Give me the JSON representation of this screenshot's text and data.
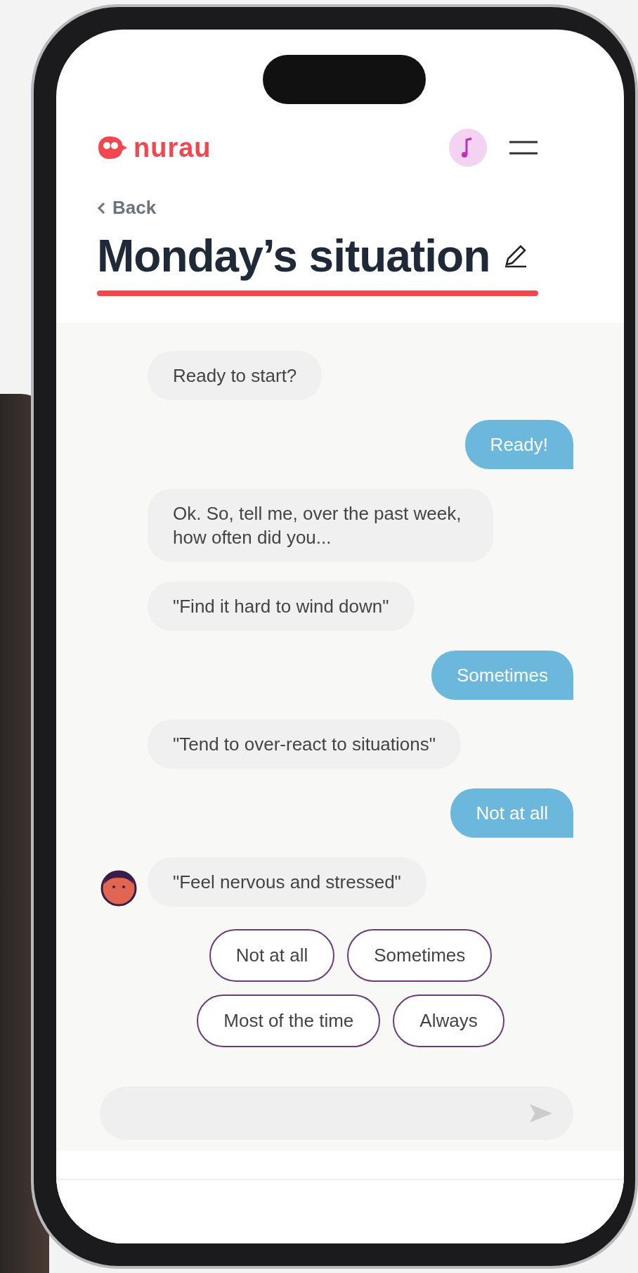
{
  "header": {
    "logo": "nurau",
    "back": "Back",
    "title": "Monday’s situation"
  },
  "messages": [
    {
      "kind": "bot",
      "text": "Ready to start?",
      "show_avatar": false
    },
    {
      "kind": "user",
      "text": "Ready!",
      "show_avatar": false
    },
    {
      "kind": "bot",
      "text": "Ok. So, tell me, over the past week, how often did you...",
      "show_avatar": false
    },
    {
      "kind": "bot",
      "text": "\"Find it hard to wind down\"",
      "show_avatar": false
    },
    {
      "kind": "user",
      "text": "Sometimes",
      "show_avatar": false
    },
    {
      "kind": "bot",
      "text": "\"Tend to over-react to situations\"",
      "show_avatar": false
    },
    {
      "kind": "user",
      "text": "Not at all",
      "show_avatar": false
    },
    {
      "kind": "bot",
      "text": "\"Feel nervous and stressed\"",
      "show_avatar": true
    }
  ],
  "quick_replies": [
    "Not at all",
    "Sometimes",
    "Most of the time",
    "Always"
  ]
}
